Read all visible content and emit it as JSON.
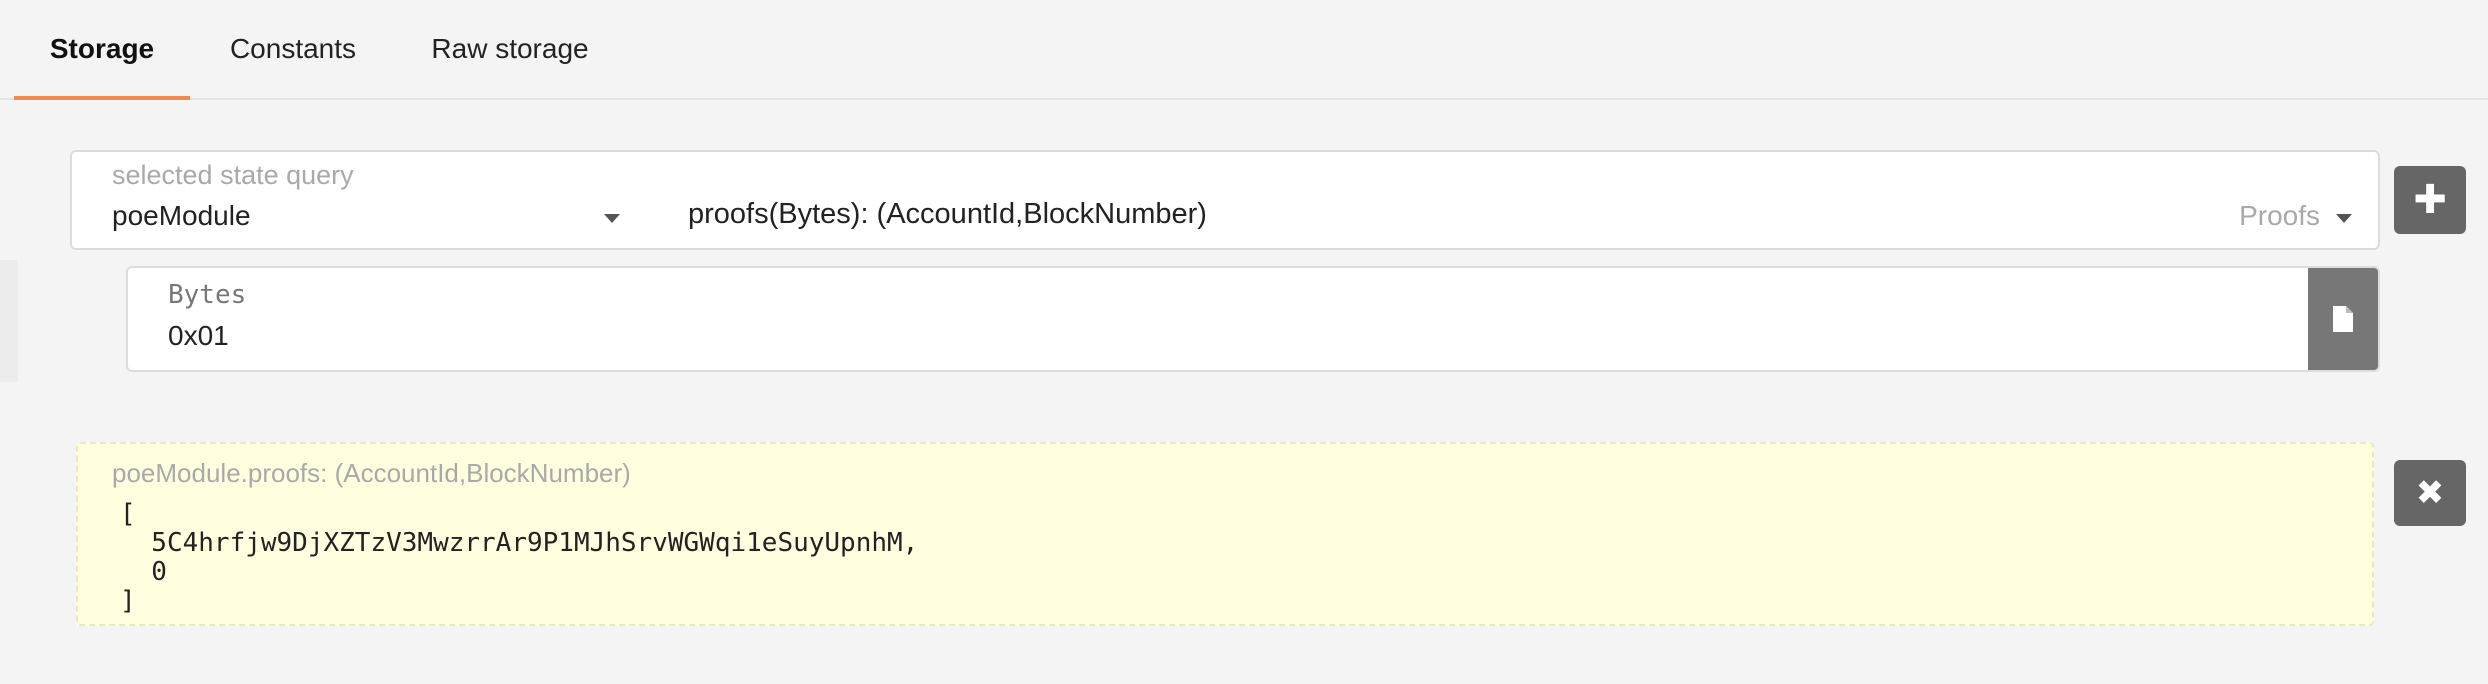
{
  "tabs": [
    {
      "label": "Storage",
      "active": true
    },
    {
      "label": "Constants",
      "active": false
    },
    {
      "label": "Raw storage",
      "active": false
    }
  ],
  "query": {
    "label": "selected state query",
    "module": "poeModule",
    "method": "proofs(Bytes): (AccountId,BlockNumber)",
    "section": "Proofs"
  },
  "param": {
    "label": "Bytes",
    "value": "0x01"
  },
  "result": {
    "label": "poeModule.proofs: (AccountId,BlockNumber)",
    "value": "[\n  5C4hrfjw9DjXZTzV3MwzrrAr9P1MJhSrvWGWqi1eSuyUpnhM,\n  0\n]"
  },
  "icons": {
    "add": "plus-icon",
    "file": "file-icon",
    "close": "close-icon"
  },
  "colors": {
    "accent": "#f08a4b",
    "button": "#666666",
    "result_bg": "#ffffdf"
  }
}
